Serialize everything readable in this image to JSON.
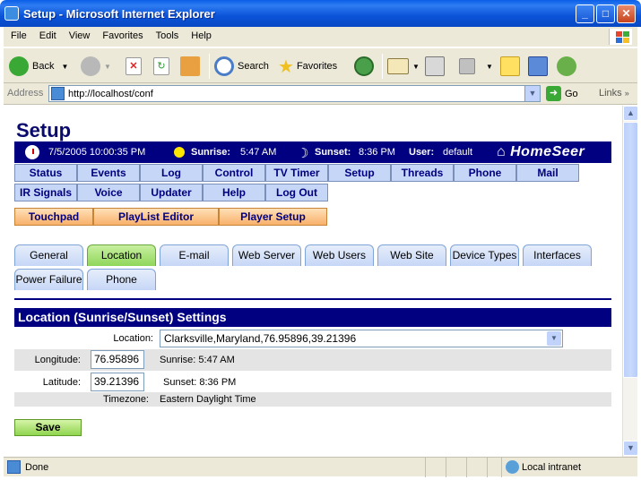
{
  "window": {
    "title": "Setup - Microsoft Internet Explorer"
  },
  "menu": [
    "File",
    "Edit",
    "View",
    "Favorites",
    "Tools",
    "Help"
  ],
  "toolbar": {
    "back": "Back",
    "search": "Search",
    "favorites": "Favorites"
  },
  "address": {
    "label": "Address",
    "url": "http://localhost/conf",
    "go": "Go",
    "links": "Links"
  },
  "status": {
    "text": "Done",
    "zone": "Local intranet"
  },
  "page": {
    "title": "Setup",
    "info": {
      "datetime": "7/5/2005 10:00:35 PM",
      "sunrise_label": "Sunrise:",
      "sunrise": "5:47 AM",
      "sunset_label": "Sunset:",
      "sunset": "8:36 PM",
      "user_label": "User:",
      "user": "default",
      "logo": "HomeSeer"
    },
    "nav_row1": [
      "Status",
      "Events",
      "Log",
      "Control",
      "TV Timer",
      "Setup",
      "Threads",
      "Phone",
      "Mail"
    ],
    "nav_row2": [
      "IR Signals",
      "Voice",
      "Updater",
      "Help",
      "Log Out"
    ],
    "nav_row3": [
      "Touchpad",
      "PlayList Editor",
      "Player Setup"
    ],
    "tabs_row1": [
      "General",
      "Location",
      "E-mail",
      "Web Server",
      "Web Users",
      "Web Site",
      "Device Types",
      "Interfaces"
    ],
    "tabs_row2": [
      "Power Failure",
      "Phone"
    ],
    "section": {
      "title": "Location (Sunrise/Sunset) Settings",
      "location_label": "Location:",
      "location_value": "Clarksville,Maryland,76.95896,39.21396",
      "longitude_label": "Longitude:",
      "longitude_value": "76.95896",
      "sunrise_text": "Sunrise: 5:47 AM",
      "latitude_label": "Latitude:",
      "latitude_value": "39.21396",
      "sunset_text": "Sunset: 8:36 PM",
      "timezone_label": "Timezone:",
      "timezone_value": "Eastern Daylight Time"
    },
    "save_label": "Save"
  }
}
